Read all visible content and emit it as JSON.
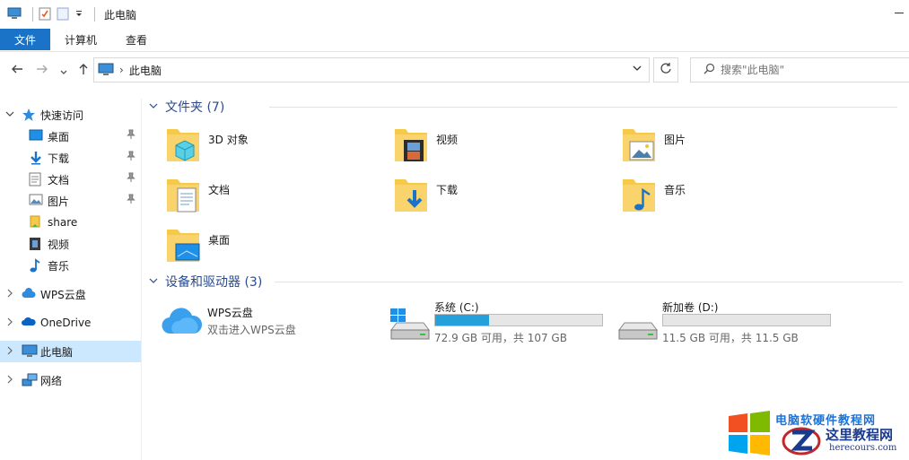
{
  "window": {
    "title": "此电脑"
  },
  "ribbon": {
    "tabs": [
      "文件",
      "计算机",
      "查看"
    ]
  },
  "address": {
    "path": "此电脑",
    "search_placeholder": "搜索\"此电脑\""
  },
  "sidebar": {
    "quick_access": "快速访问",
    "quick_items": [
      "桌面",
      "下载",
      "文档",
      "图片",
      "share",
      "视频",
      "音乐"
    ],
    "wps": "WPS云盘",
    "onedrive": "OneDrive",
    "this_pc": "此电脑",
    "network": "网络"
  },
  "folders": {
    "header": "文件夹 (7)",
    "items": [
      "3D 对象",
      "视频",
      "图片",
      "文档",
      "下载",
      "音乐",
      "桌面"
    ]
  },
  "devices": {
    "header": "设备和驱动器 (3)",
    "wps": {
      "name": "WPS云盘",
      "subtitle": "双击进入WPS云盘"
    },
    "drives": [
      {
        "name": "系统 (C:)",
        "free": "72.9 GB 可用，共 107 GB",
        "used_fraction": 0.32
      },
      {
        "name": "新加卷 (D:)",
        "free": "11.5 GB 可用，共 11.5 GB",
        "used_fraction": 0.0
      }
    ]
  },
  "watermark": {
    "line1": "电脑软硬件教程网",
    "brand": "这里教程网",
    "url": "herecours.com"
  },
  "colors": {
    "accent": "#1a73c6",
    "selection": "#cce8ff",
    "folder": "#f7c948",
    "drive_fill": "#26a0da"
  }
}
